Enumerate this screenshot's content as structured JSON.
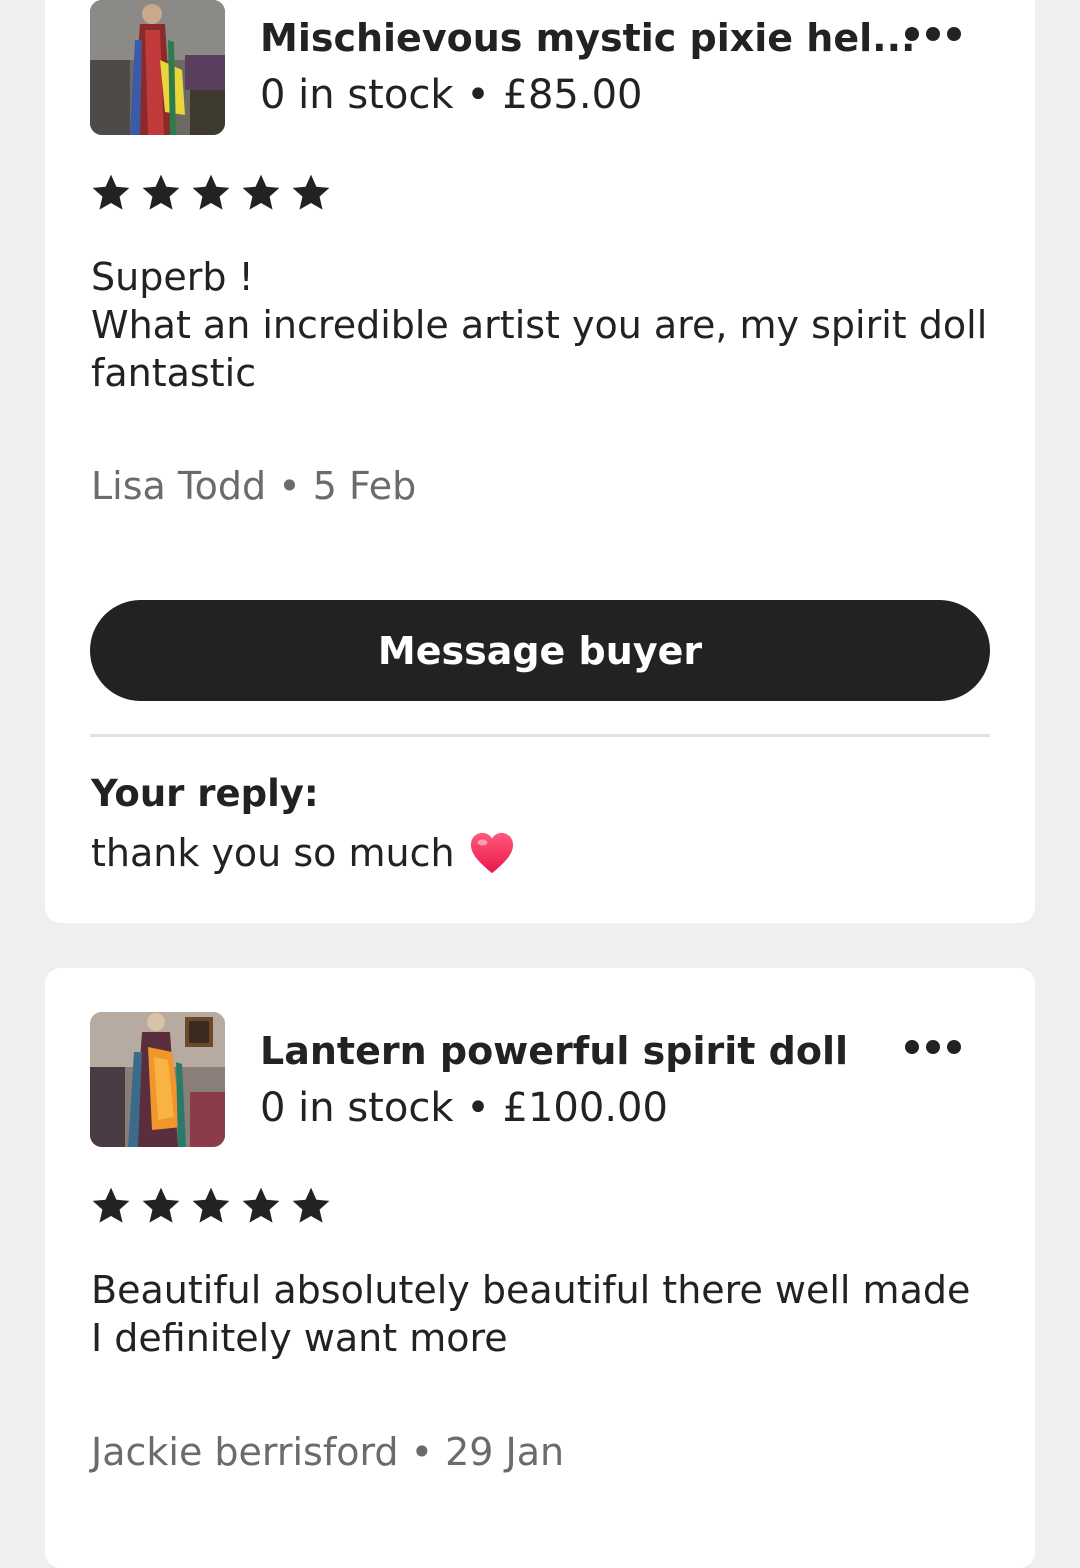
{
  "reviews": [
    {
      "listing_title": "Mischievous mystic pixie hel...",
      "listing_meta": "0 in stock • £85.00",
      "rating": 5,
      "review_text": "Superb !\nWhat an incredible artist you are, my spirit doll fantastic",
      "reviewer_line": "Lisa Todd • 5 Feb",
      "message_button_label": "Message buyer",
      "reply_label": "Your reply:",
      "reply_text": "thank you so much",
      "reply_emoji": "heart-emoji"
    },
    {
      "listing_title": "Lantern powerful spirit doll",
      "listing_meta": "0 in stock • £100.00",
      "rating": 5,
      "review_text": "Beautiful absolutely beautiful there well made I definitely want more",
      "reviewer_line": "Jackie berrisford • 29 Jan"
    }
  ],
  "colors": {
    "background": "#efefef",
    "card": "#ffffff",
    "text": "#222222",
    "muted_text": "#6b6b6b",
    "button": "#222222",
    "heart": "#f0325a"
  },
  "icons": [
    "star-icon",
    "more-options-icon",
    "heart-emoji"
  ]
}
